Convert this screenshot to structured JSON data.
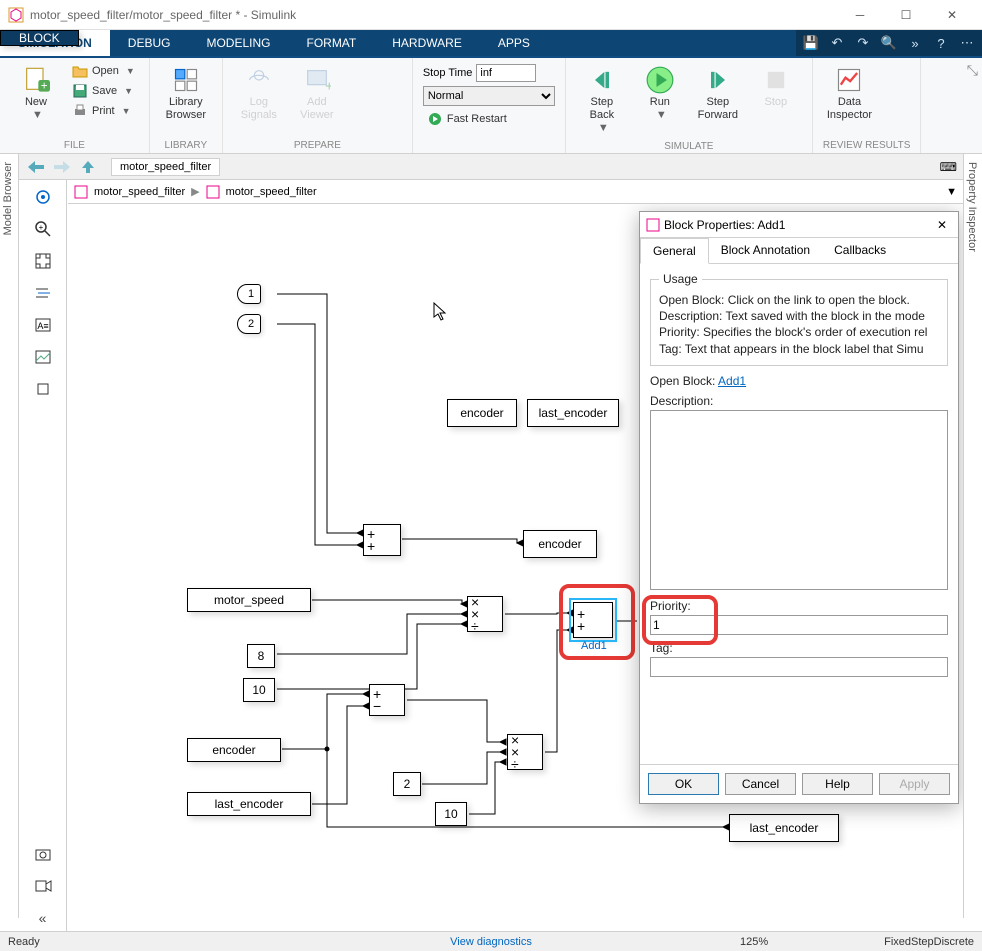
{
  "window": {
    "title": "motor_speed_filter/motor_speed_filter * - Simulink"
  },
  "ribbon_tabs": [
    "SIMULATION",
    "DEBUG",
    "MODELING",
    "FORMAT",
    "HARDWARE",
    "APPS",
    "BLOCK"
  ],
  "ribbon": {
    "file": {
      "new": "New",
      "open": "Open",
      "save": "Save",
      "print": "Print",
      "group": "FILE"
    },
    "library": {
      "btn": "Library\nBrowser",
      "group": "LIBRARY"
    },
    "prepare": {
      "signals": "Log\nSignals",
      "viewer": "Add\nViewer",
      "stoptime_label": "Stop Time",
      "stoptime": "inf",
      "mode": "Normal",
      "fast": "Fast Restart",
      "group": "PREPARE"
    },
    "simulate": {
      "stepback": "Step\nBack",
      "run": "Run",
      "stepfwd": "Step\nForward",
      "stop": "Stop",
      "group": "SIMULATE"
    },
    "review": {
      "inspector": "Data\nInspector",
      "group": "REVIEW RESULTS"
    }
  },
  "sidepanels": {
    "left": "Model Browser",
    "right": "Property Inspector"
  },
  "tab_name": "motor_speed_filter",
  "breadcrumb": {
    "a": "motor_speed_filter",
    "b": "motor_speed_filter"
  },
  "blocks": {
    "in1": "1",
    "in2": "2",
    "encoder_top": "encoder",
    "last_encoder_top": "last_encoder",
    "encoder_out": "encoder",
    "motor_speed": "motor_speed",
    "c8": "8",
    "c10a": "10",
    "encoder_from": "encoder",
    "last_encoder_from": "last_encoder",
    "c2": "2",
    "c10b": "10",
    "add1_label": "Add1",
    "last_encoder_out": "last_encoder"
  },
  "dialog": {
    "title": "Block Properties: Add1",
    "tabs": [
      "General",
      "Block Annotation",
      "Callbacks"
    ],
    "usage_legend": "Usage",
    "usage_text": "Open Block: Click on the link to open the block.\nDescription: Text saved with the block in the mode\nPriority: Specifies the block's order of execution rel\nTag: Text that appears in the block label that Simu",
    "openblock_label": "Open Block:",
    "openblock_link": "Add1",
    "description_label": "Description:",
    "description_value": "",
    "priority_label": "Priority:",
    "priority_value": "1",
    "tag_label": "Tag:",
    "tag_value": "",
    "buttons": {
      "ok": "OK",
      "cancel": "Cancel",
      "help": "Help",
      "apply": "Apply"
    }
  },
  "status": {
    "ready": "Ready",
    "diag": "View diagnostics",
    "zoom": "125%",
    "solver": "FixedStepDiscrete"
  }
}
